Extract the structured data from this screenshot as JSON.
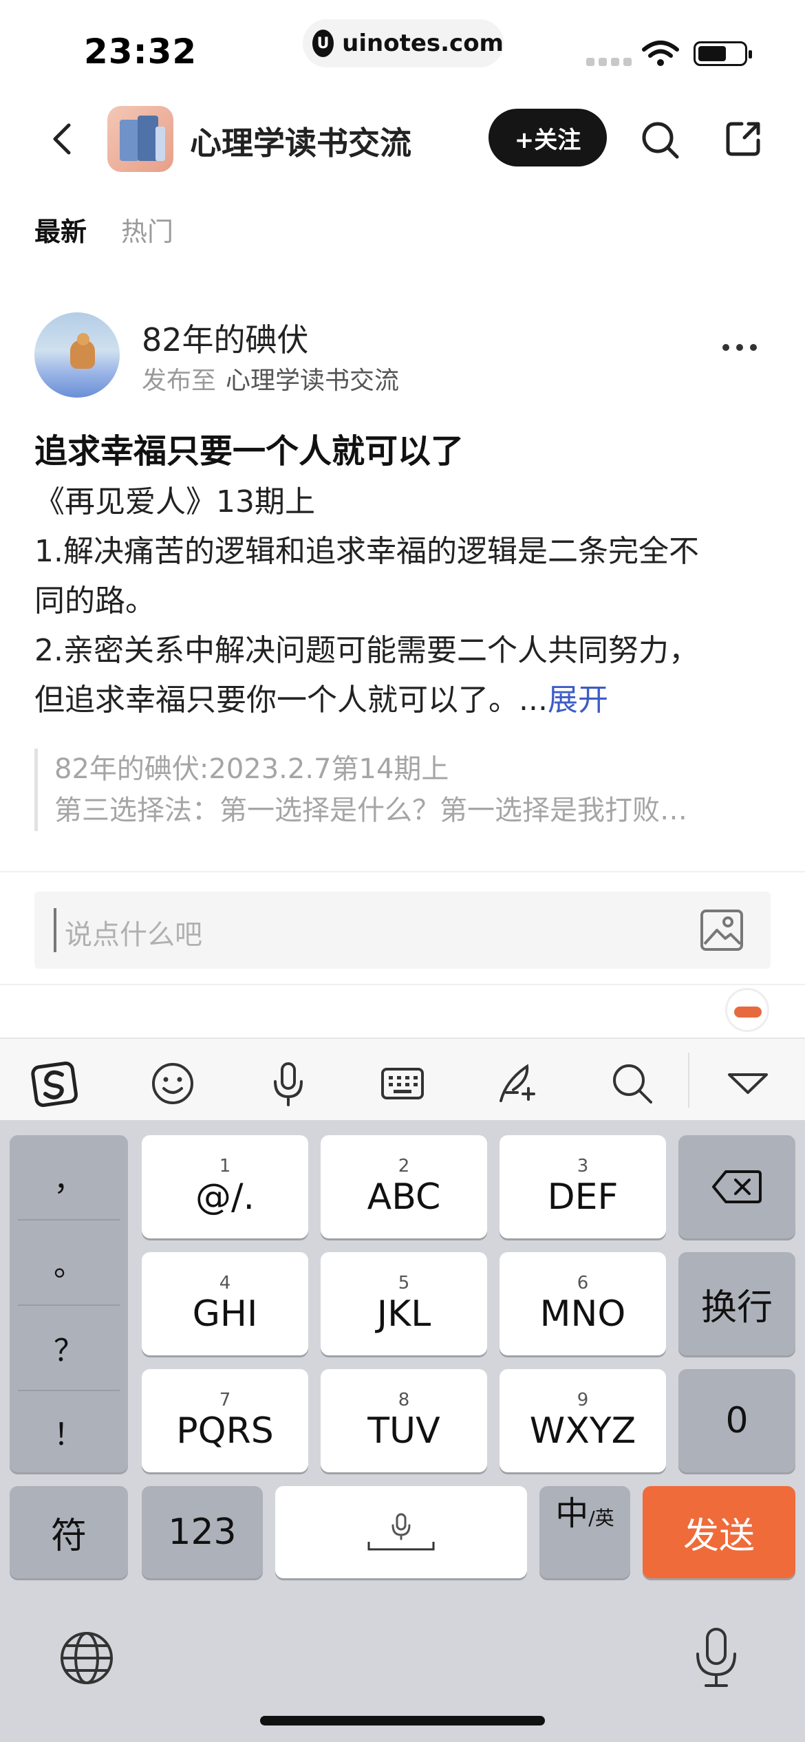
{
  "status_bar": {
    "time": "23:32",
    "url": "uinotes.com",
    "url_logo": "U"
  },
  "header": {
    "title": "心理学读书交流",
    "follow_label": "+关注"
  },
  "tabs": [
    {
      "label": "最新",
      "active": true
    },
    {
      "label": "热门",
      "active": false
    }
  ],
  "post": {
    "author": "82年的碘伏",
    "published_prefix": "发布至",
    "published_group": "心理学读书交流",
    "title": "追求幸福只要一个人就可以了",
    "lines": [
      "《再见爱人》13期上",
      "1.解决痛苦的逻辑和追求幸福的逻辑是二条完全不",
      "同的路。",
      "2.亲密关系中解决问题可能需要二个人共同努力，",
      "但追求幸福只要你一个人就可以了。..."
    ],
    "expand_label": "展开",
    "quote": [
      "82年的碘伏:2023.2.7第14期上",
      "第三选择法：第一选择是什么？第一选择是我打败…"
    ]
  },
  "comment": {
    "placeholder": "说点什么吧"
  },
  "keyboard": {
    "punctuation": [
      "，",
      "。",
      "？",
      "！"
    ],
    "keys": [
      {
        "num": "1",
        "label": "@/."
      },
      {
        "num": "2",
        "label": "ABC"
      },
      {
        "num": "3",
        "label": "DEF"
      },
      {
        "num": "4",
        "label": "GHI"
      },
      {
        "num": "5",
        "label": "JKL"
      },
      {
        "num": "6",
        "label": "MNO"
      },
      {
        "num": "7",
        "label": "PQRS"
      },
      {
        "num": "8",
        "label": "TUV"
      },
      {
        "num": "9",
        "label": "WXYZ"
      }
    ],
    "return_label": "换行",
    "zero_label": "0",
    "symbols_label": "符",
    "numbers_label": "123",
    "lang_main": "中",
    "lang_sub": "/英",
    "send_label": "发送"
  },
  "colors": {
    "accent_link": "#3d5cc6",
    "send_button": "#ef6b3a",
    "follow_button": "#151515"
  },
  "icons": {
    "back": "chevron-left-icon",
    "search": "search-icon",
    "share": "share-icon",
    "more": "more-dots-icon",
    "image": "image-icon",
    "backspace": "backspace-icon",
    "globe": "globe-icon",
    "mic": "microphone-icon"
  }
}
